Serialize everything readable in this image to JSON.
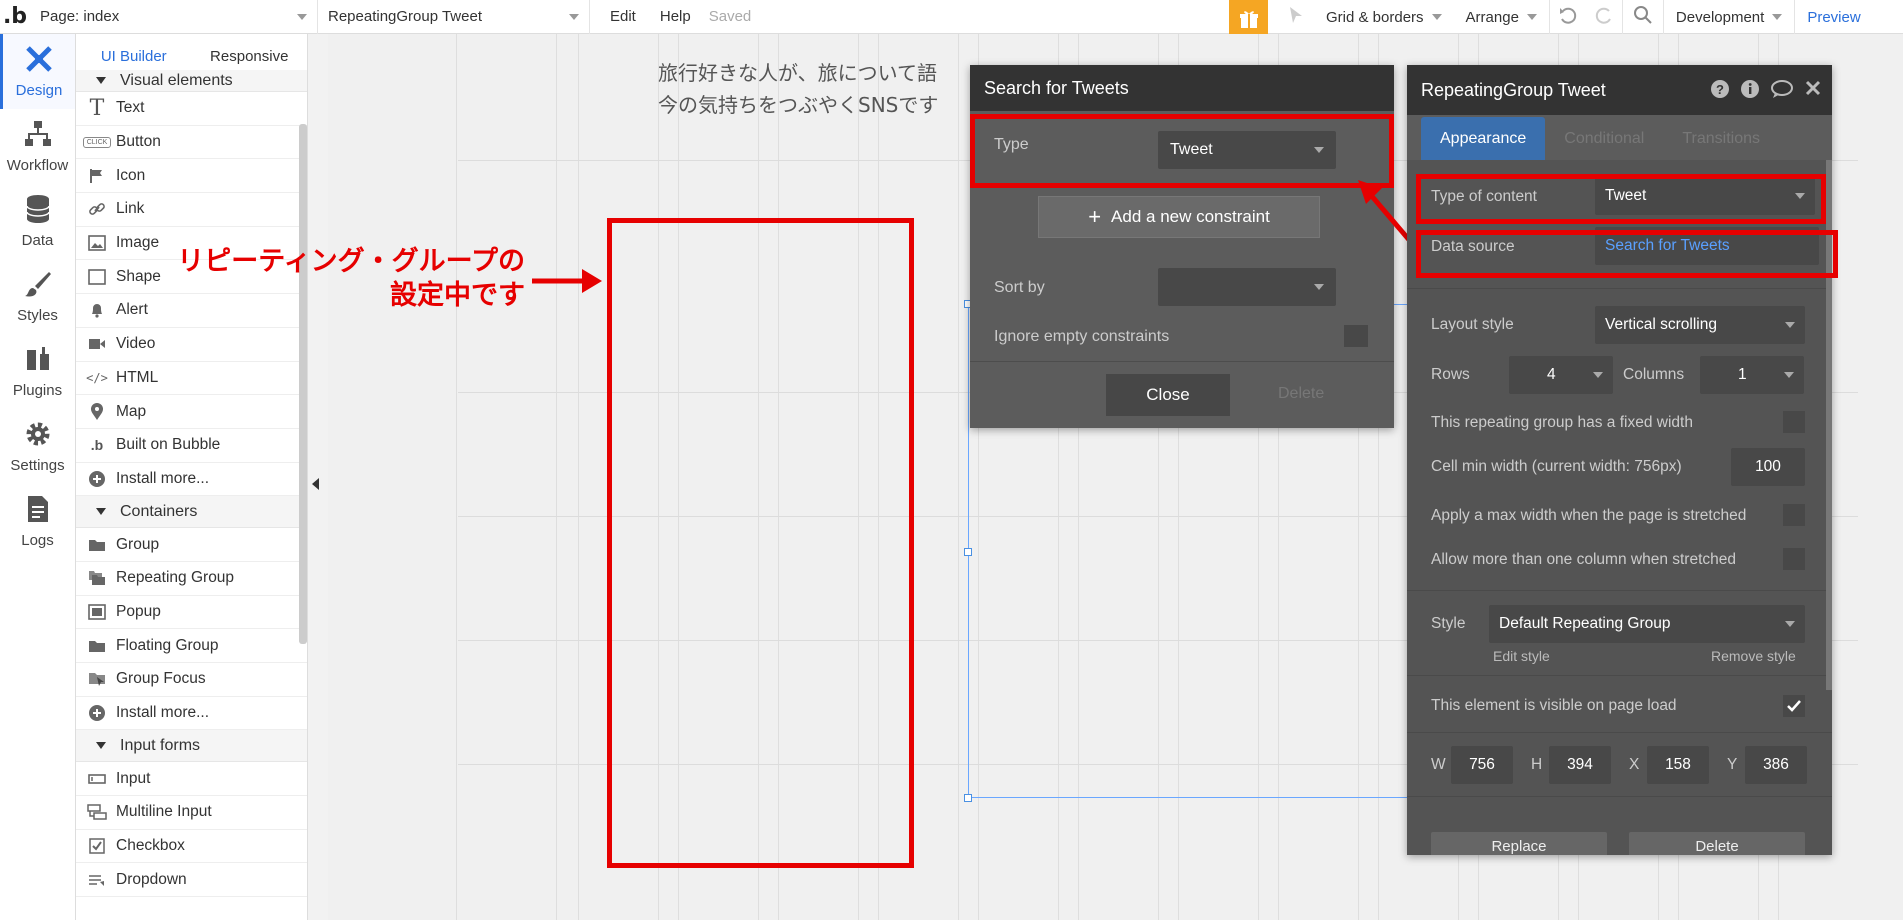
{
  "topbar": {
    "page_select": "Page: index",
    "element_select": "RepeatingGroup Tweet",
    "edit": "Edit",
    "help": "Help",
    "saved": "Saved",
    "grid_borders": "Grid & borders",
    "arrange": "Arrange",
    "environment": "Development",
    "preview": "Preview"
  },
  "leftnav": {
    "items": [
      {
        "label": "Design",
        "icon": "design-icon"
      },
      {
        "label": "Workflow",
        "icon": "workflow-icon"
      },
      {
        "label": "Data",
        "icon": "data-icon"
      },
      {
        "label": "Styles",
        "icon": "styles-icon"
      },
      {
        "label": "Plugins",
        "icon": "plugins-icon"
      },
      {
        "label": "Settings",
        "icon": "settings-icon"
      },
      {
        "label": "Logs",
        "icon": "logs-icon"
      }
    ]
  },
  "palette": {
    "tabs": [
      "UI Builder",
      "Responsive"
    ],
    "visual_section": "Visual elements",
    "visual_items": [
      "Text",
      "Button",
      "Icon",
      "Link",
      "Image",
      "Shape",
      "Alert",
      "Video",
      "HTML",
      "Map",
      "Built on Bubble",
      "Install more..."
    ],
    "containers_section": "Containers",
    "container_items": [
      "Group",
      "Repeating Group",
      "Popup",
      "Floating Group",
      "Group Focus",
      "Install more..."
    ],
    "input_section": "Input forms",
    "input_items": [
      "Input",
      "Multiline Input",
      "Checkbox",
      "Dropdown"
    ]
  },
  "canvas": {
    "text_line1": "旅行好きな人が、旅について語",
    "text_line2": "今の気持ちをつぶやくSNSです",
    "annotation_line1": "リピーティング・グループの",
    "annotation_line2": "設定中です"
  },
  "search_dialog": {
    "title": "Search for Tweets",
    "type_label": "Type",
    "type_value": "Tweet",
    "add_constraint": "Add a new constraint",
    "sort_by_label": "Sort by",
    "ignore_empty_label": "Ignore empty constraints",
    "close": "Close",
    "delete": "Delete"
  },
  "prop_editor": {
    "title": "RepeatingGroup Tweet",
    "tabs": [
      "Appearance",
      "Conditional",
      "Transitions"
    ],
    "type_of_content_label": "Type of content",
    "type_of_content_value": "Tweet",
    "data_source_label": "Data source",
    "data_source_value": "Search for Tweets",
    "layout_style_label": "Layout style",
    "layout_style_value": "Vertical scrolling",
    "rows_label": "Rows",
    "rows_value": "4",
    "columns_label": "Columns",
    "columns_value": "1",
    "fixed_width_label": "This repeating group has a fixed width",
    "cell_min_width_label": "Cell min width (current width: 756px)",
    "cell_min_width_value": "100",
    "max_width_label": "Apply a max width when the page is stretched",
    "multi_column_label": "Allow more than one column when stretched",
    "style_label": "Style",
    "style_value": "Default Repeating Group",
    "edit_style": "Edit style",
    "remove_style": "Remove style",
    "visible_label": "This element is visible on page load",
    "w_label": "W",
    "w_value": "756",
    "h_label": "H",
    "h_value": "394",
    "x_label": "X",
    "x_value": "158",
    "y_label": "Y",
    "y_value": "386",
    "replace": "Replace",
    "delete": "Delete"
  },
  "colors": {
    "accent": "#2a6fdb",
    "annotation": "#e60000",
    "gift": "#f5a623",
    "panel": "#5c5c5c"
  }
}
